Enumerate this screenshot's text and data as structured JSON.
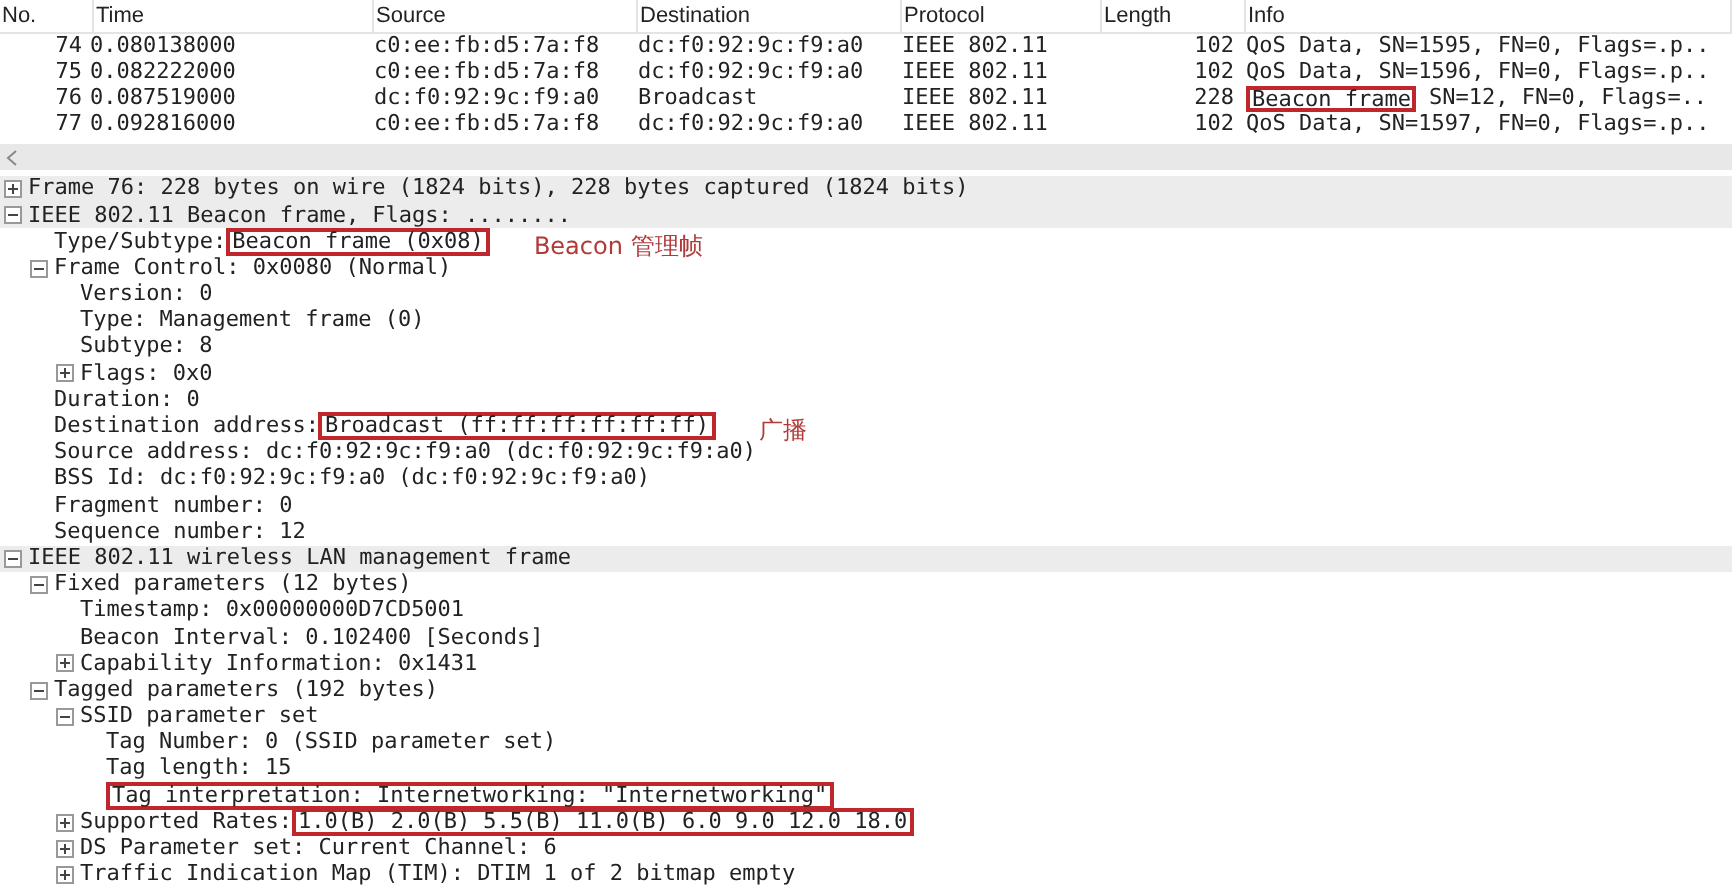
{
  "packet_list": {
    "columns": [
      "No.",
      "Time",
      "Source",
      "Destination",
      "Protocol",
      "Length",
      "Info"
    ],
    "rows": [
      {
        "no": "74",
        "time": "0.080138000",
        "source": "c0:ee:fb:d5:7a:f8",
        "destination": "dc:f0:92:9c:f9:a0",
        "protocol": "IEEE 802.11",
        "length": "102",
        "info": "QoS Data, SN=1595, FN=0, Flags=.p.."
      },
      {
        "no": "75",
        "time": "0.082222000",
        "source": "c0:ee:fb:d5:7a:f8",
        "destination": "dc:f0:92:9c:f9:a0",
        "protocol": "IEEE 802.11",
        "length": "102",
        "info": "QoS Data, SN=1596, FN=0, Flags=.p.."
      },
      {
        "no": "76",
        "time": "0.087519000",
        "source": "dc:f0:92:9c:f9:a0",
        "destination": "Broadcast",
        "protocol": "IEEE 802.11",
        "length": "228",
        "info_boxed": "Beacon frame",
        "info": "SN=12, FN=0, Flags=.."
      },
      {
        "no": "77",
        "time": "0.092816000",
        "source": "c0:ee:fb:d5:7a:f8",
        "destination": "dc:f0:92:9c:f9:a0",
        "protocol": "IEEE 802.11",
        "length": "102",
        "info": "QoS Data, SN=1597, FN=0, Flags=.p.."
      }
    ]
  },
  "details": [
    {
      "label": "Frame 76: 228 bytes on wire (1824 bits), 228 bytes captured (1824 bits)",
      "expanded": false
    },
    {
      "label": "IEEE 802.11 Beacon frame, Flags: ........",
      "expanded": true,
      "children": [
        {
          "label": "Type/Subtype: ",
          "boxed": "Beacon frame (0x08)",
          "note": "Beacon 管理帧"
        },
        {
          "label": "Frame Control: 0x0080 (Normal)",
          "expanded": true,
          "children": [
            {
              "label": "Version: 0"
            },
            {
              "label": "Type: Management frame (0)"
            },
            {
              "label": "Subtype: 8"
            },
            {
              "label": "Flags: 0x0",
              "expanded": false
            }
          ]
        },
        {
          "label": "Duration: 0"
        },
        {
          "label": "Destination address: ",
          "boxed": "Broadcast (ff:ff:ff:ff:ff:ff)",
          "note": "广播"
        },
        {
          "label": "Source address: dc:f0:92:9c:f9:a0 (dc:f0:92:9c:f9:a0)"
        },
        {
          "label": "BSS Id: dc:f0:92:9c:f9:a0 (dc:f0:92:9c:f9:a0)"
        },
        {
          "label": "Fragment number: 0"
        },
        {
          "label": "Sequence number: 12"
        }
      ]
    },
    {
      "label": "IEEE 802.11 wireless LAN management frame",
      "expanded": true,
      "children": [
        {
          "label": "Fixed parameters (12 bytes)",
          "expanded": true,
          "children": [
            {
              "label": "Timestamp: 0x00000000D7CD5001"
            },
            {
              "label": "Beacon Interval: 0.102400 [Seconds]"
            },
            {
              "label": "Capability Information: 0x1431",
              "expanded": false
            }
          ]
        },
        {
          "label": "Tagged parameters (192 bytes)",
          "expanded": true,
          "children": [
            {
              "label": "SSID parameter set",
              "expanded": true,
              "children": [
                {
                  "label": "Tag Number: 0 (SSID parameter set)"
                },
                {
                  "label": "Tag length: 15"
                },
                {
                  "boxed": "Tag interpretation: Internetworking: \"Internetworking\""
                }
              ]
            },
            {
              "label": "Supported Rates: ",
              "boxed": "1.0(B) 2.0(B) 5.5(B) 11.0(B) 6.0 9.0 12.0 18.0",
              "expanded": false
            },
            {
              "label": "DS Parameter set: Current Channel: 6",
              "expanded": false
            },
            {
              "label": "Traffic Indication Map (TIM): DTIM 1 of 2 bitmap empty",
              "expanded": false
            }
          ]
        }
      ]
    }
  ]
}
